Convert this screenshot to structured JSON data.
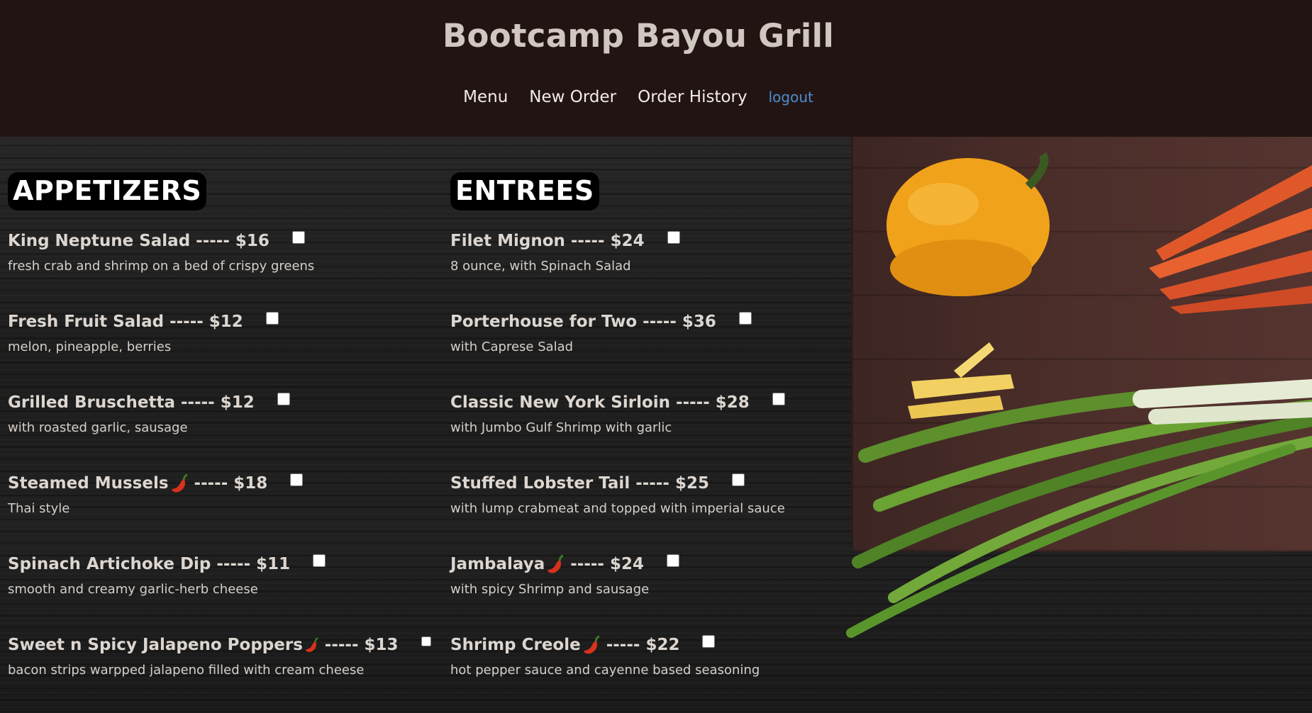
{
  "header": {
    "title": "Bootcamp Bayou Grill",
    "nav": [
      {
        "label": "Menu"
      },
      {
        "label": "New Order"
      },
      {
        "label": "Order History"
      },
      {
        "label": "logout"
      }
    ]
  },
  "colors": {
    "header_bg": "#231414",
    "logout_link": "#4d8ed0",
    "heading_bg": "#000000"
  },
  "icons": {
    "spicy": "chili-pepper-icon"
  },
  "appetizers": {
    "heading": "APPETIZERS",
    "items": [
      {
        "name": "King Neptune Salad",
        "separator": "-----",
        "price": "$16",
        "desc": "fresh crab and shrimp on a bed of crispy greens",
        "spicy": false,
        "checked": false
      },
      {
        "name": "Fresh Fruit Salad",
        "separator": "-----",
        "price": "$12",
        "desc": "melon, pineapple, berries",
        "spicy": false,
        "checked": false
      },
      {
        "name": "Grilled Bruschetta",
        "separator": "-----",
        "price": "$12",
        "desc": "with roasted garlic, sausage",
        "spicy": false,
        "checked": false
      },
      {
        "name": "Steamed Mussels",
        "separator": "-----",
        "price": "$18",
        "desc": "Thai style",
        "spicy": true,
        "checked": false
      },
      {
        "name": "Spinach Artichoke Dip",
        "separator": "-----",
        "price": "$11",
        "desc": "smooth and creamy garlic-herb cheese",
        "spicy": false,
        "checked": false
      },
      {
        "name": "Sweet n Spicy Jalapeno Poppers",
        "separator": "-----",
        "price": "$13",
        "desc": "bacon strips warpped jalapeno filled with cream cheese",
        "spicy": true,
        "checked": false
      }
    ]
  },
  "entrees": {
    "heading": "ENTREES",
    "items": [
      {
        "name": "Filet Mignon",
        "separator": "-----",
        "price": "$24",
        "desc": "8 ounce, with Spinach Salad",
        "spicy": false,
        "checked": false
      },
      {
        "name": "Porterhouse for Two",
        "separator": "-----",
        "price": "$36",
        "desc": "with Caprese Salad",
        "spicy": false,
        "checked": false
      },
      {
        "name": "Classic New York Sirloin",
        "separator": "-----",
        "price": "$28",
        "desc": "with Jumbo Gulf Shrimp with garlic",
        "spicy": false,
        "checked": false
      },
      {
        "name": "Stuffed Lobster Tail",
        "separator": "-----",
        "price": "$25",
        "desc": "with lump crabmeat and topped with imperial sauce",
        "spicy": false,
        "checked": false
      },
      {
        "name": "Jambalaya",
        "separator": "-----",
        "price": "$24",
        "desc": "with spicy Shrimp and sausage",
        "spicy": true,
        "checked": false
      },
      {
        "name": "Shrimp Creole",
        "separator": "-----",
        "price": "$22",
        "desc": "hot pepper sauce and cayenne based seasoning",
        "spicy": true,
        "checked": false
      }
    ]
  }
}
